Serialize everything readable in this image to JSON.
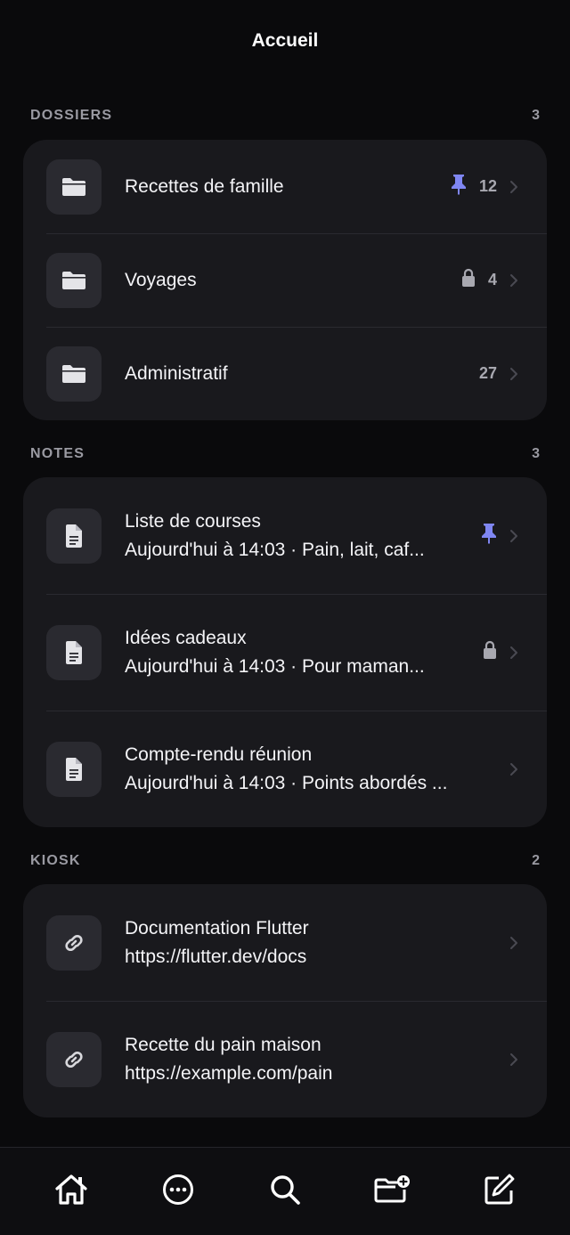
{
  "header": {
    "title": "Accueil"
  },
  "dossiers": {
    "title": "DOSSIERS",
    "count": "3",
    "items": [
      {
        "label": "Recettes de famille",
        "count": "12",
        "badge": "pin-icon"
      },
      {
        "label": "Voyages",
        "count": "4",
        "badge": "lock-icon"
      },
      {
        "label": "Administratif",
        "count": "27",
        "badge": ""
      }
    ]
  },
  "notes": {
    "title": "NOTES",
    "count": "3",
    "items": [
      {
        "title": "Liste de courses",
        "subtitle": "Aujourd'hui à 14:03 · Pain, lait, caf...",
        "badge": "pin-icon"
      },
      {
        "title": "Idées cadeaux",
        "subtitle": "Aujourd'hui à 14:03 · Pour maman...",
        "badge": "lock-icon"
      },
      {
        "title": "Compte-rendu réunion",
        "subtitle": "Aujourd'hui à 14:03 · Points abordés ...",
        "badge": ""
      }
    ]
  },
  "kiosk": {
    "title": "KIOSK",
    "count": "2",
    "items": [
      {
        "title": "Documentation Flutter",
        "subtitle": "https://flutter.dev/docs"
      },
      {
        "title": "Recette du pain maison",
        "subtitle": "https://example.com/pain"
      }
    ]
  },
  "tabbar": {
    "tabs": [
      {
        "icon": "home-icon"
      },
      {
        "icon": "more-icon"
      },
      {
        "icon": "search-icon"
      },
      {
        "icon": "new-folder-icon"
      },
      {
        "icon": "compose-icon"
      }
    ]
  },
  "colors": {
    "background": "#0a0a0c",
    "card": "#19191d",
    "accent": "#7f86f2",
    "muted": "#9a9aa2"
  }
}
